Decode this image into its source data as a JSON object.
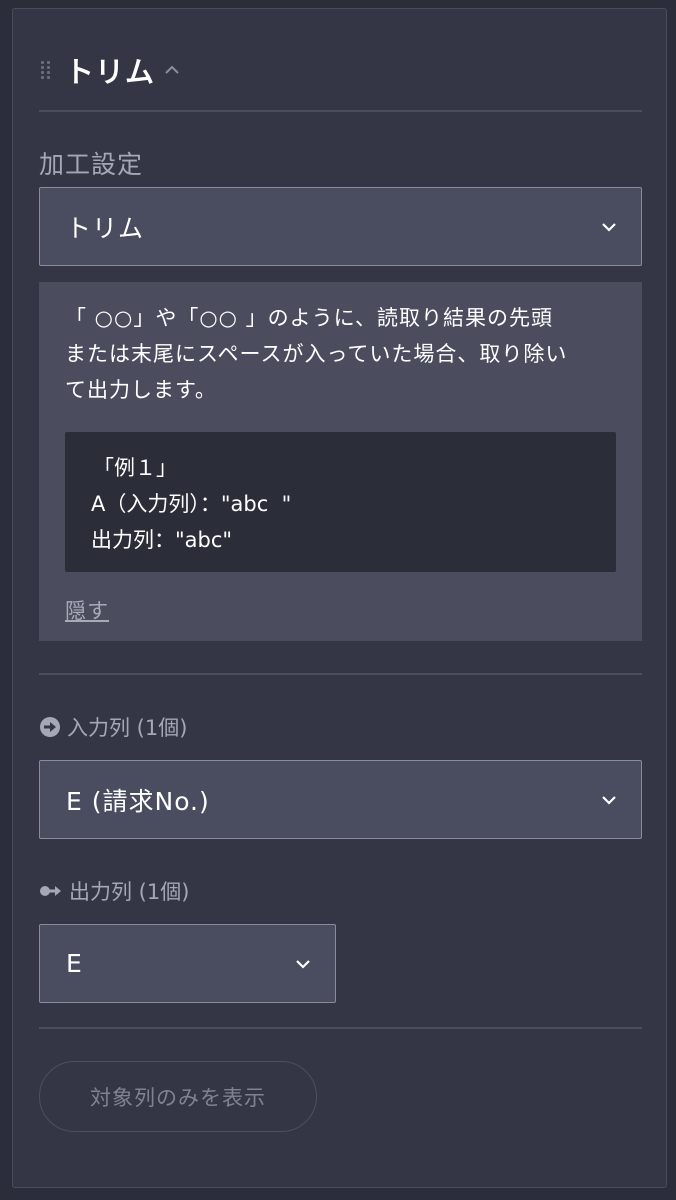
{
  "header": {
    "title": "トリム"
  },
  "processing": {
    "label": "加工設定",
    "selected": "トリム"
  },
  "info": {
    "lines": [
      "「 ○○」や「○○ 」のように、読取り結果の先頭",
      "または末尾にスペースが入っていた場合、取り除い",
      "て出力します。"
    ],
    "example": [
      "「例１」",
      "A（入力列）：\"abc  \"",
      "出力列：\"abc\""
    ],
    "hide_label": "隠す"
  },
  "input_column": {
    "label": "入力列 (1個)",
    "selected": "E (請求No.)"
  },
  "output_column": {
    "label": "出力列 (1個)",
    "selected": "E"
  },
  "show_only_button": {
    "label": "対象列のみを表示"
  },
  "colors": {
    "background": "#343645",
    "select_bg": "#4a4c60",
    "info_bg": "#4b4d5f",
    "example_bg": "#2b2d38",
    "muted_text": "#a5a7b5"
  }
}
